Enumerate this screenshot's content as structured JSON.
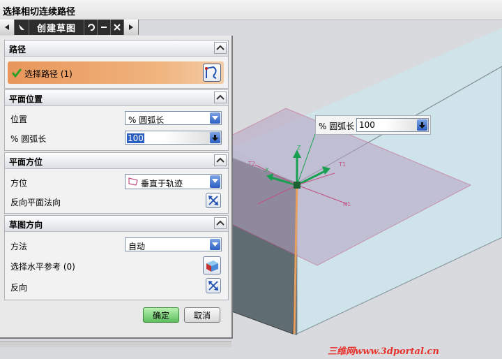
{
  "window": {
    "title": "选择相切连续路径"
  },
  "toolbar": {
    "label": "创建草图"
  },
  "sections": {
    "path": {
      "title": "路径",
      "select_label": "选择路径 (1)"
    },
    "plane_position": {
      "title": "平面位置",
      "position_label": "位置",
      "position_value": "% 圆弧长",
      "arc_label": "% 圆弧长",
      "arc_value": "100"
    },
    "plane_orientation": {
      "title": "平面方位",
      "orient_label": "方位",
      "orient_value": "垂直于轨迹",
      "reverse_normal_label": "反向平面法向"
    },
    "sketch_direction": {
      "title": "草图方向",
      "method_label": "方法",
      "method_value": "自动",
      "horizontal_ref_label": "选择水平参考 (0)",
      "reverse_label": "反向"
    }
  },
  "buttons": {
    "ok": "确定",
    "cancel": "取消"
  },
  "float_input": {
    "label": "% 圆弧长",
    "value": "100"
  },
  "axes": {
    "z": "Z",
    "t1": "T1",
    "n1": "N1",
    "x": "X",
    "t2": "T2"
  },
  "watermark": "三维网www.3dportal.cn",
  "colors": {
    "accent_blue": "#2c5fc2",
    "path_highlight": "#e8a060",
    "plane_edge": "#c05080",
    "ok_green": "#5fbf5f"
  }
}
